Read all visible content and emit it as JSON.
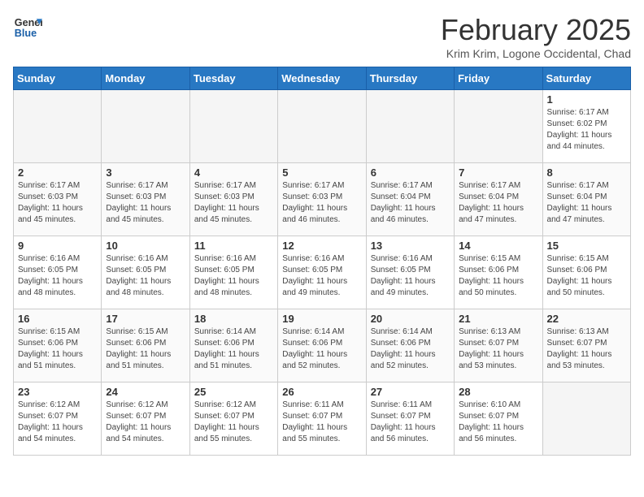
{
  "header": {
    "logo_line1": "General",
    "logo_line2": "Blue",
    "title": "February 2025",
    "location": "Krim Krim, Logone Occidental, Chad"
  },
  "weekdays": [
    "Sunday",
    "Monday",
    "Tuesday",
    "Wednesday",
    "Thursday",
    "Friday",
    "Saturday"
  ],
  "weeks": [
    [
      {
        "day": "",
        "info": ""
      },
      {
        "day": "",
        "info": ""
      },
      {
        "day": "",
        "info": ""
      },
      {
        "day": "",
        "info": ""
      },
      {
        "day": "",
        "info": ""
      },
      {
        "day": "",
        "info": ""
      },
      {
        "day": "1",
        "info": "Sunrise: 6:17 AM\nSunset: 6:02 PM\nDaylight: 11 hours and 44 minutes."
      }
    ],
    [
      {
        "day": "2",
        "info": "Sunrise: 6:17 AM\nSunset: 6:03 PM\nDaylight: 11 hours and 45 minutes."
      },
      {
        "day": "3",
        "info": "Sunrise: 6:17 AM\nSunset: 6:03 PM\nDaylight: 11 hours and 45 minutes."
      },
      {
        "day": "4",
        "info": "Sunrise: 6:17 AM\nSunset: 6:03 PM\nDaylight: 11 hours and 45 minutes."
      },
      {
        "day": "5",
        "info": "Sunrise: 6:17 AM\nSunset: 6:03 PM\nDaylight: 11 hours and 46 minutes."
      },
      {
        "day": "6",
        "info": "Sunrise: 6:17 AM\nSunset: 6:04 PM\nDaylight: 11 hours and 46 minutes."
      },
      {
        "day": "7",
        "info": "Sunrise: 6:17 AM\nSunset: 6:04 PM\nDaylight: 11 hours and 47 minutes."
      },
      {
        "day": "8",
        "info": "Sunrise: 6:17 AM\nSunset: 6:04 PM\nDaylight: 11 hours and 47 minutes."
      }
    ],
    [
      {
        "day": "9",
        "info": "Sunrise: 6:16 AM\nSunset: 6:05 PM\nDaylight: 11 hours and 48 minutes."
      },
      {
        "day": "10",
        "info": "Sunrise: 6:16 AM\nSunset: 6:05 PM\nDaylight: 11 hours and 48 minutes."
      },
      {
        "day": "11",
        "info": "Sunrise: 6:16 AM\nSunset: 6:05 PM\nDaylight: 11 hours and 48 minutes."
      },
      {
        "day": "12",
        "info": "Sunrise: 6:16 AM\nSunset: 6:05 PM\nDaylight: 11 hours and 49 minutes."
      },
      {
        "day": "13",
        "info": "Sunrise: 6:16 AM\nSunset: 6:05 PM\nDaylight: 11 hours and 49 minutes."
      },
      {
        "day": "14",
        "info": "Sunrise: 6:15 AM\nSunset: 6:06 PM\nDaylight: 11 hours and 50 minutes."
      },
      {
        "day": "15",
        "info": "Sunrise: 6:15 AM\nSunset: 6:06 PM\nDaylight: 11 hours and 50 minutes."
      }
    ],
    [
      {
        "day": "16",
        "info": "Sunrise: 6:15 AM\nSunset: 6:06 PM\nDaylight: 11 hours and 51 minutes."
      },
      {
        "day": "17",
        "info": "Sunrise: 6:15 AM\nSunset: 6:06 PM\nDaylight: 11 hours and 51 minutes."
      },
      {
        "day": "18",
        "info": "Sunrise: 6:14 AM\nSunset: 6:06 PM\nDaylight: 11 hours and 51 minutes."
      },
      {
        "day": "19",
        "info": "Sunrise: 6:14 AM\nSunset: 6:06 PM\nDaylight: 11 hours and 52 minutes."
      },
      {
        "day": "20",
        "info": "Sunrise: 6:14 AM\nSunset: 6:06 PM\nDaylight: 11 hours and 52 minutes."
      },
      {
        "day": "21",
        "info": "Sunrise: 6:13 AM\nSunset: 6:07 PM\nDaylight: 11 hours and 53 minutes."
      },
      {
        "day": "22",
        "info": "Sunrise: 6:13 AM\nSunset: 6:07 PM\nDaylight: 11 hours and 53 minutes."
      }
    ],
    [
      {
        "day": "23",
        "info": "Sunrise: 6:12 AM\nSunset: 6:07 PM\nDaylight: 11 hours and 54 minutes."
      },
      {
        "day": "24",
        "info": "Sunrise: 6:12 AM\nSunset: 6:07 PM\nDaylight: 11 hours and 54 minutes."
      },
      {
        "day": "25",
        "info": "Sunrise: 6:12 AM\nSunset: 6:07 PM\nDaylight: 11 hours and 55 minutes."
      },
      {
        "day": "26",
        "info": "Sunrise: 6:11 AM\nSunset: 6:07 PM\nDaylight: 11 hours and 55 minutes."
      },
      {
        "day": "27",
        "info": "Sunrise: 6:11 AM\nSunset: 6:07 PM\nDaylight: 11 hours and 56 minutes."
      },
      {
        "day": "28",
        "info": "Sunrise: 6:10 AM\nSunset: 6:07 PM\nDaylight: 11 hours and 56 minutes."
      },
      {
        "day": "",
        "info": ""
      }
    ]
  ]
}
